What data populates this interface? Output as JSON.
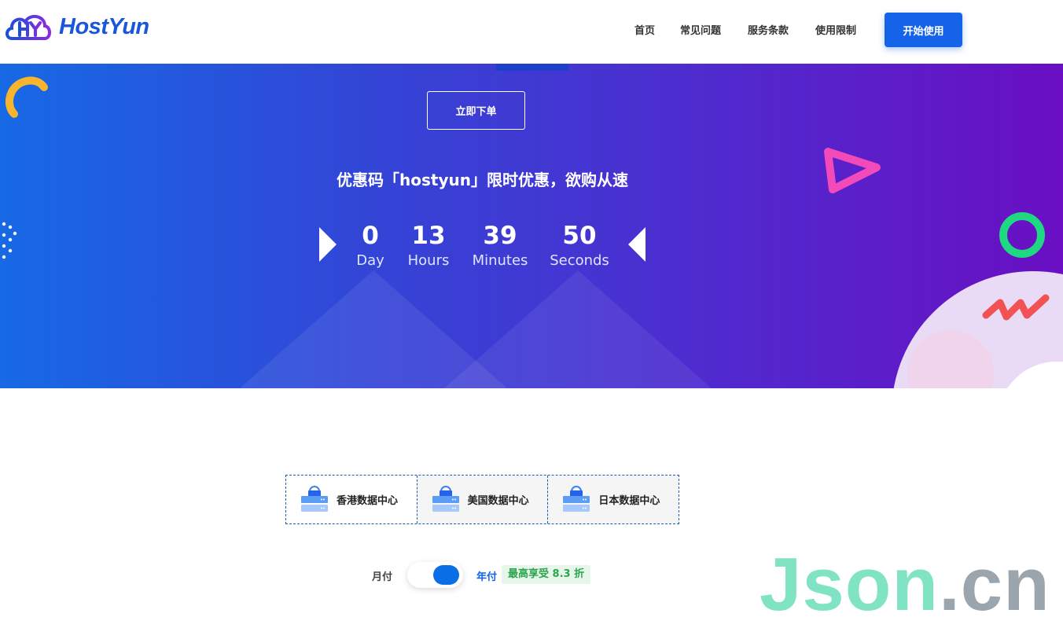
{
  "header": {
    "brand": "HostYun",
    "nav": [
      {
        "label": "首页"
      },
      {
        "label": "常见问题"
      },
      {
        "label": "服务条款"
      },
      {
        "label": "使用限制"
      }
    ],
    "cta_label": "开始使用",
    "accent_color": "#1463e8"
  },
  "hero": {
    "order_button": "立即下单",
    "promo_text": "优惠码「hostyun」限时优惠，欲购从速",
    "countdown": [
      {
        "value": "0",
        "label": "Day"
      },
      {
        "value": "13",
        "label": "Hours"
      },
      {
        "value": "39",
        "label": "Minutes"
      },
      {
        "value": "50",
        "label": "Seconds"
      }
    ]
  },
  "datacenters": {
    "tabs": [
      {
        "label": "香港数据中心",
        "icon": "server-icon"
      },
      {
        "label": "美国数据中心",
        "icon": "server-icon"
      },
      {
        "label": "日本数据中心",
        "icon": "server-icon"
      }
    ]
  },
  "billing": {
    "monthly": "月付",
    "yearly": "年付",
    "discount": "最高享受 8.3 折",
    "selected": "年付"
  },
  "watermark": {
    "part1": "Json",
    "part2": ".cn"
  }
}
